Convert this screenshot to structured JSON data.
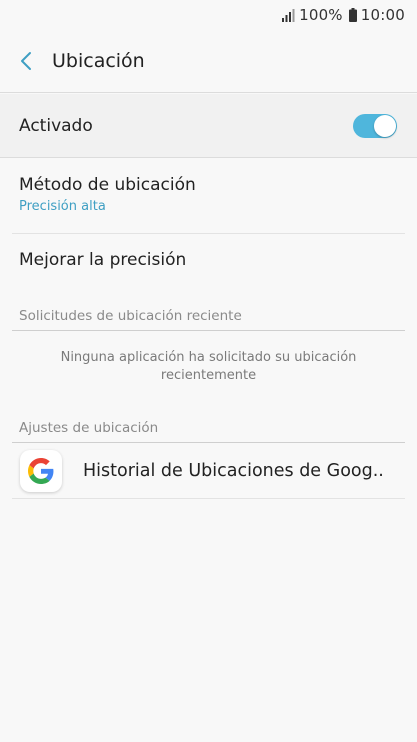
{
  "status_bar": {
    "battery_percent": "100%",
    "time": "10:00"
  },
  "app_bar": {
    "title": "Ubicación"
  },
  "master_switch": {
    "label": "Activado",
    "on": true
  },
  "settings": {
    "location_method": {
      "title": "Método de ubicación",
      "value": "Precisión alta"
    },
    "improve_accuracy": {
      "title": "Mejorar la precisión"
    }
  },
  "recent_requests": {
    "header": "Solicitudes de ubicación reciente",
    "empty_message_line1": "Ninguna aplicación ha solicitado su ubicación",
    "empty_message_line2": "recientemente"
  },
  "location_settings": {
    "header": "Ajustes de ubicación",
    "items": [
      {
        "label": "Historial de Ubicaciones de Goog..",
        "icon": "google-icon"
      }
    ]
  },
  "colors": {
    "accent": "#3f9fc3",
    "toggle_track": "#4fb6dc"
  }
}
